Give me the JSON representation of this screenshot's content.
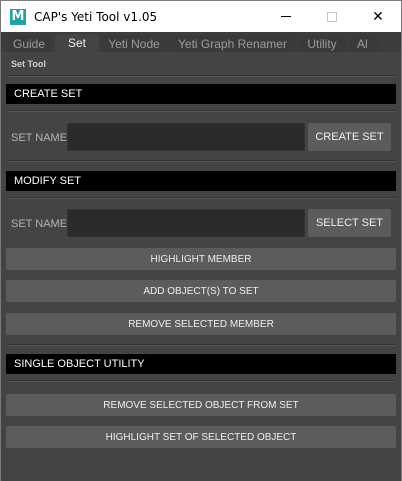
{
  "window": {
    "title": "CAP's Yeti Tool v1.05",
    "icon_letter": "M",
    "icon_color": "#1fa3a8",
    "minimize_icon": "minimize-icon",
    "maximize_icon": "maximize-icon",
    "close_glyph": "✕"
  },
  "tabs": [
    {
      "label": "Guide",
      "active": false
    },
    {
      "label": "Set",
      "active": true
    },
    {
      "label": "Yeti Node",
      "active": false
    },
    {
      "label": "Yeti Graph Renamer",
      "active": false
    },
    {
      "label": "Utility",
      "active": false
    },
    {
      "label": "Al",
      "active": false
    }
  ],
  "caption": "Set Tool",
  "create_set": {
    "header": "CREATE SET",
    "field_label": "SET NAME",
    "field_value": "",
    "button": "CREATE SET"
  },
  "modify_set": {
    "header": "MODIFY SET",
    "field_label": "SET NAME",
    "field_value": "",
    "select_button": "SELECT SET",
    "highlight_button": "HIGHLIGHT MEMBER",
    "add_button": "ADD OBJECT(S) TO SET",
    "remove_button": "REMOVE SELECTED MEMBER"
  },
  "single_object": {
    "header": "SINGLE OBJECT UTILITY",
    "remove_button": "REMOVE SELECTED OBJECT FROM SET",
    "highlight_button": "HIGHLIGHT SET OF SELECTED OBJECT"
  }
}
